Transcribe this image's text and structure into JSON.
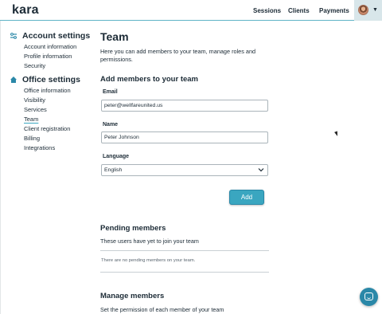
{
  "app": {
    "logo": "kara"
  },
  "topnav": {
    "sessions": "Sessions",
    "clients": "Clients",
    "payments": "Payments",
    "user_menu_icon": "chevron-down-icon"
  },
  "sidebar": {
    "account_heading": "Account settings",
    "account_items": [
      "Account information",
      "Profile information",
      "Security"
    ],
    "office_heading": "Office settings",
    "office_items": [
      "Office information",
      "Visibility",
      "Services",
      "Team",
      "Client registration",
      "Billing",
      "Integrations"
    ],
    "active_item": "Team"
  },
  "main": {
    "title": "Team",
    "intro": "Here you can add members to your team, manage roles and permissions.",
    "add_section": {
      "title": "Add members to your team",
      "email_label": "Email",
      "email_value": "peter@wellfareunited.us",
      "name_label": "Name",
      "name_value": "Peter Johnson",
      "language_label": "Language",
      "language_value": "English",
      "add_button": "Add"
    },
    "pending_section": {
      "title": "Pending members",
      "description": "These users have yet to join your team",
      "empty": "There are no pending members on your team."
    },
    "manage_section": {
      "title": "Manage members",
      "description": "Set the permission of each member of your team"
    }
  },
  "colors": {
    "accent": "#3aa6c0",
    "accent_dark": "#2a88a8",
    "text": "#1c2b36"
  }
}
